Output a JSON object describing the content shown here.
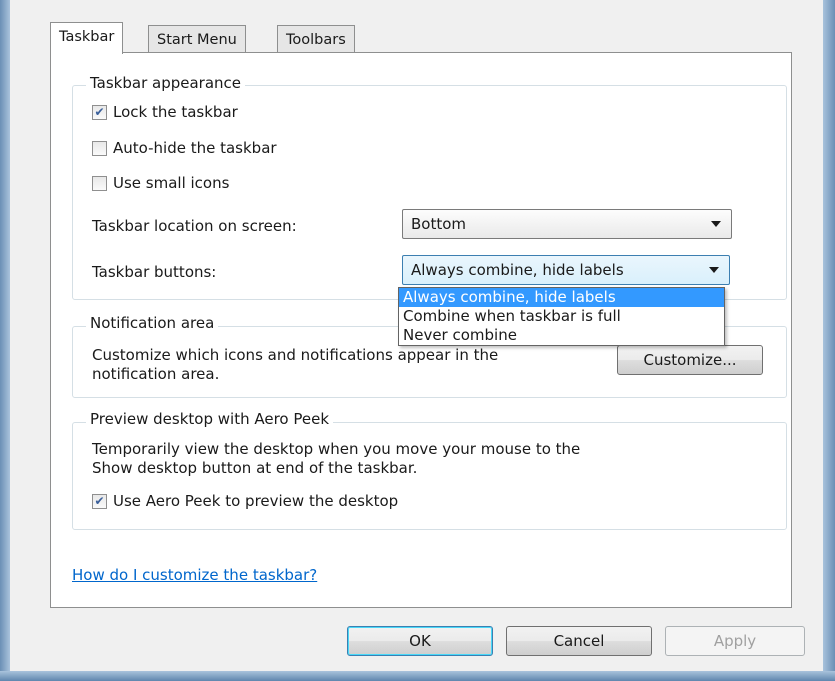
{
  "tabs": [
    {
      "label": "Taskbar",
      "active": true
    },
    {
      "label": "Start Menu",
      "active": false
    },
    {
      "label": "Toolbars",
      "active": false
    }
  ],
  "taskbar_appearance": {
    "legend": "Taskbar appearance",
    "lock": {
      "label": "Lock the taskbar",
      "checked": true
    },
    "autohide": {
      "label": "Auto-hide the taskbar",
      "checked": false
    },
    "small_icons": {
      "label": "Use small icons",
      "checked": false
    },
    "location_label": "Taskbar location on screen:",
    "location_value": "Bottom",
    "buttons_label": "Taskbar buttons:",
    "buttons_value": "Always combine, hide labels",
    "buttons_options": [
      "Always combine, hide labels",
      "Combine when taskbar is full",
      "Never combine"
    ]
  },
  "notification": {
    "legend": "Notification area",
    "description_line1": "Customize which icons and notifications appear in the",
    "description_line2": "notification area.",
    "customize_button": "Customize..."
  },
  "aero_peek": {
    "legend": "Preview desktop with Aero Peek",
    "description_line1": "Temporarily view the desktop when you move your mouse to the",
    "description_line2": "Show desktop button at end of the taskbar.",
    "use_peek": {
      "label": "Use Aero Peek to preview the desktop",
      "checked": true
    }
  },
  "help_link": "How do I customize the taskbar?",
  "buttons": {
    "ok": "OK",
    "cancel": "Cancel",
    "apply": "Apply"
  },
  "colors": {
    "selection": "#3399ff",
    "link": "#0066cc",
    "frame": "#a9c3dc"
  }
}
